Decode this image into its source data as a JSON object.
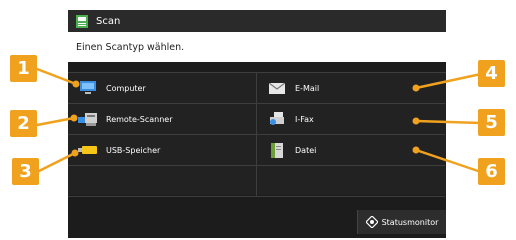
{
  "window": {
    "title": "Scan"
  },
  "prompt": "Einen Scantyp wählen.",
  "left_items": [
    {
      "label": "Computer",
      "icon": "computer-icon"
    },
    {
      "label": "Remote-Scanner",
      "icon": "remote-scanner-icon"
    },
    {
      "label": "USB-Speicher",
      "icon": "usb-memory-icon"
    }
  ],
  "right_items": [
    {
      "label": "E-Mail",
      "icon": "email-icon"
    },
    {
      "label": "I-Fax",
      "icon": "ifax-icon"
    },
    {
      "label": "Datei",
      "icon": "file-icon"
    }
  ],
  "status_button": {
    "label": "Statusmonitor",
    "icon": "status-monitor-icon"
  },
  "callouts": [
    "1",
    "2",
    "3",
    "4",
    "5",
    "6"
  ],
  "colors": {
    "callout": "#f0a21e",
    "screen_bg": "#1c1c1c",
    "cell_bg": "#222222"
  }
}
